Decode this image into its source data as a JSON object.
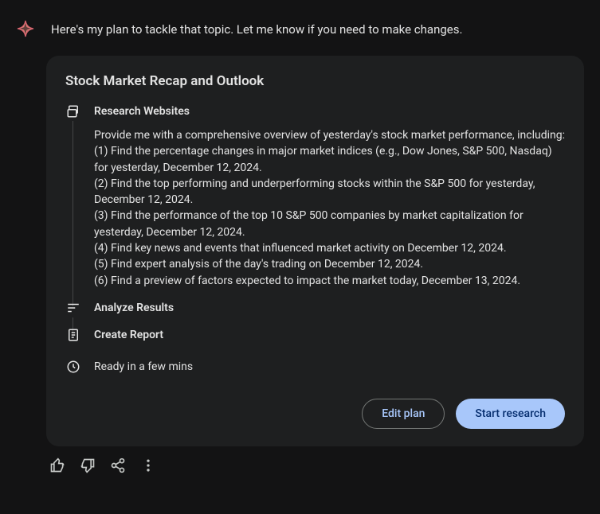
{
  "intro": "Here's my plan to tackle that topic. Let me know if you need to make changes.",
  "plan": {
    "title": "Stock Market Recap and Outlook",
    "steps": {
      "research": {
        "title": "Research Websites",
        "intro": "Provide me with a comprehensive overview of yesterday's stock market performance, including:",
        "items": [
          "(1) Find the percentage changes in major market indices (e.g., Dow Jones, S&P 500, Nasdaq) for yesterday, December 12, 2024.",
          "(2) Find the top performing and underperforming stocks within the S&P 500 for yesterday, December 12, 2024.",
          "(3) Find the performance of the top 10 S&P 500 companies by market capitalization for yesterday, December 12, 2024.",
          "(4) Find key news and events that influenced market activity on December 12, 2024.",
          "(5) Find expert analysis of the day's trading on December 12, 2024.",
          "(6) Find a preview of factors expected to impact the market today, December 13, 2024."
        ]
      },
      "analyze": {
        "title": "Analyze Results"
      },
      "report": {
        "title": "Create Report"
      }
    },
    "status": "Ready in a few mins",
    "buttons": {
      "edit": "Edit plan",
      "start": "Start research"
    }
  }
}
